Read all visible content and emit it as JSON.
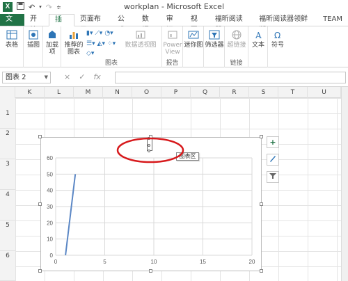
{
  "window": {
    "title": "workplan - Microsoft Excel",
    "app_icon_text": "X",
    "qat": [
      "save-icon",
      "undo-icon",
      "redo-icon",
      "customize-icon"
    ]
  },
  "tabs": [
    {
      "label": "文件",
      "kind": "file"
    },
    {
      "label": "开始"
    },
    {
      "label": "插入",
      "active": true
    },
    {
      "label": "页面布局"
    },
    {
      "label": "公式"
    },
    {
      "label": "数据"
    },
    {
      "label": "审阅"
    },
    {
      "label": "视图"
    },
    {
      "label": "福昕阅读器"
    },
    {
      "label": "福昕阅读器领鲜版"
    },
    {
      "label": "TEAM"
    }
  ],
  "ribbon": {
    "table": "表格",
    "illustrations": "插图",
    "addins_line1": "加载",
    "addins_line2": "项",
    "recommended_charts_line1": "推荐的",
    "recommended_charts_line2": "图表",
    "pivot_chart": "数据透视图",
    "power_view_line1": "Power",
    "power_view_line2": "View",
    "sparklines": "迷你图",
    "filters": "筛选器",
    "hyperlink": "超链接",
    "text": "文本",
    "symbols": "符号",
    "group_charts": "图表",
    "group_reports": "报告",
    "group_links": "链接"
  },
  "formula_bar": {
    "name_box": "图表 2",
    "fx": "fx",
    "cancel": "×",
    "enter": "✓"
  },
  "columns": [
    "K",
    "L",
    "M",
    "N",
    "O",
    "P",
    "Q",
    "R",
    "S",
    "T",
    "U"
  ],
  "rows": [
    "1",
    "2",
    "3",
    "4",
    "5",
    "6"
  ],
  "chart_tooltip": "图表区",
  "side_buttons": [
    "add-element-icon",
    "chart-styles-icon",
    "chart-filter-icon"
  ],
  "colors": {
    "excel_green": "#217346",
    "series_line": "#5b87c5",
    "annotation_red": "#d7191c"
  },
  "chart_data": {
    "type": "line",
    "title": "",
    "xlabel": "",
    "ylabel": "",
    "xlim": [
      0,
      20
    ],
    "ylim": [
      0,
      60
    ],
    "xticks": [
      0,
      5,
      10,
      15,
      20
    ],
    "yticks": [
      0,
      10,
      20,
      30,
      40,
      50,
      60
    ],
    "grid": true,
    "legend": "none",
    "series": [
      {
        "x": [
          1,
          2
        ],
        "y": [
          0,
          50
        ]
      }
    ]
  }
}
